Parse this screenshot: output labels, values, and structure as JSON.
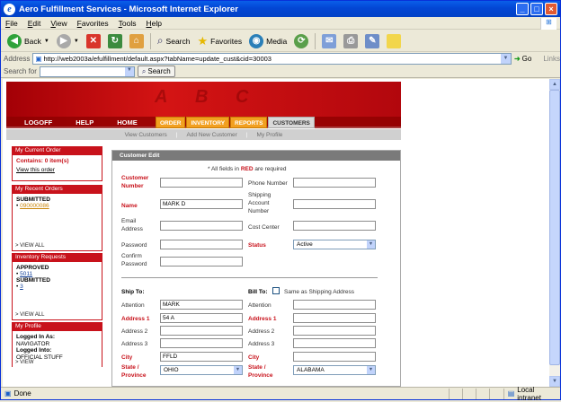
{
  "window": {
    "title": "Aero Fulfillment Services - Microsoft Internet Explorer"
  },
  "menu": [
    "File",
    "Edit",
    "View",
    "Favorites",
    "Tools",
    "Help"
  ],
  "toolbar": {
    "back": "Back",
    "search": "Search",
    "favorites": "Favorites",
    "media": "Media"
  },
  "address": {
    "label": "Address",
    "url": "http://web2003a/efulfillment/default.aspx?tabName=update_cust&cid=30003",
    "go": "Go",
    "links": "Links"
  },
  "searchbar": {
    "label": "Search for",
    "button": "Search"
  },
  "site": {
    "nav": {
      "logoff": "LOGOFF",
      "help": "HELP",
      "home": "HOME"
    },
    "tabs": [
      "ORDER",
      "INVENTORY",
      "REPORTS",
      "CUSTOMERS"
    ],
    "subnav": [
      "View Customers",
      "Add New Customer",
      "My Profile"
    ],
    "sidebar": {
      "current_order": {
        "title": "My Current Order",
        "contains": "Contains: 0 item(s)",
        "view": "View this order"
      },
      "recent_orders": {
        "title": "My Recent Orders",
        "status": "SUBMITTED",
        "order": "090000086",
        "view_all": "> VIEW ALL"
      },
      "inventory_requests": {
        "title": "Inventory Requests",
        "approved": "APPROVED",
        "approved_item": "5011",
        "submitted": "SUBMITTED",
        "submitted_item": "3",
        "view_all": "> VIEW ALL"
      },
      "profile": {
        "title": "My Profile",
        "logged_as_label": "Logged In As:",
        "logged_as": "NAVIGATOR",
        "logged_into_label": "Logged Into:",
        "logged_into": "OFFICIAL STUFF",
        "view": "> VIEW"
      }
    },
    "form": {
      "title": "Customer Edit",
      "required_prefix": "* All fields in",
      "required_red": "RED",
      "required_suffix": "are required",
      "labels": {
        "customer_number": "Customer Number",
        "name": "Name",
        "email": "Email Address",
        "password": "Password",
        "confirm_password": "Confirm Password",
        "phone": "Phone Number",
        "shipping_account": "Shipping Account Number",
        "cost_center": "Cost Center",
        "status": "Status",
        "ship_to": "Ship To:",
        "bill_to": "Bill To:",
        "same_as_shipping": "Same as Shipping Address",
        "attention": "Attention",
        "address1": "Address 1",
        "address2": "Address 2",
        "address3": "Address 3",
        "city": "City",
        "state": "State / Province"
      },
      "values": {
        "customer_number": "",
        "name": "MARK D",
        "email": "",
        "password": "",
        "confirm_password": "",
        "phone": "",
        "shipping_account": "",
        "cost_center": "",
        "status": "Active",
        "ship_attention": "MARK",
        "ship_address1": "54 A",
        "ship_address2": "",
        "ship_address3": "",
        "ship_city": "FFLD",
        "ship_state": "OHIO",
        "bill_attention": "",
        "bill_address1": "",
        "bill_address2": "",
        "bill_address3": "",
        "bill_city": "",
        "bill_state": "ALABAMA"
      }
    }
  },
  "statusbar": {
    "status": "Done",
    "zone": "Local intranet"
  }
}
